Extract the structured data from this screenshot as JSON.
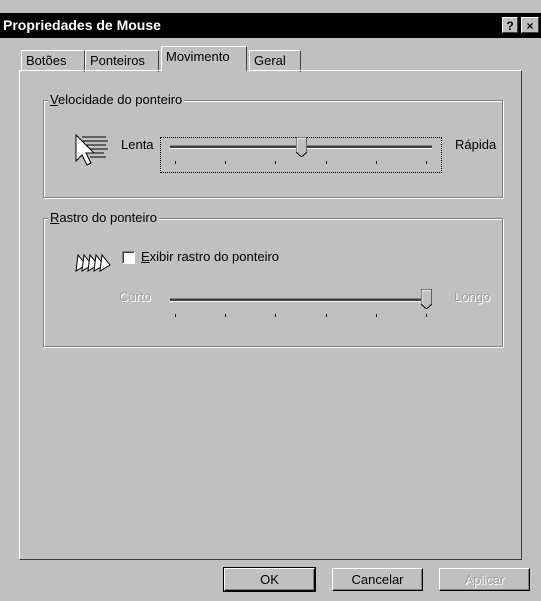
{
  "window": {
    "title": "Propriedades de Mouse",
    "help_label": "?",
    "close_label": "×"
  },
  "tabs": [
    {
      "label": "Botões",
      "active": false
    },
    {
      "label": "Ponteiros",
      "active": false
    },
    {
      "label": "Movimento",
      "active": true
    },
    {
      "label": "Geral",
      "active": false
    }
  ],
  "speed_group": {
    "legend_mnemonic": "V",
    "legend_rest": "elocidade do ponteiro",
    "min_label": "Lenta",
    "max_label": "Rápida",
    "value_fraction": 0.5,
    "icon": "pointer-speed-icon"
  },
  "trail_group": {
    "legend_mnemonic": "R",
    "legend_rest": "astro do ponteiro",
    "checkbox_mnemonic": "E",
    "checkbox_rest": "xibir rastro do ponteiro",
    "checked": false,
    "min_label": "Curto",
    "max_label": "Longo",
    "value_fraction": 1.0,
    "enabled": false,
    "icon": "pointer-trail-icon"
  },
  "buttons": {
    "ok": "OK",
    "cancel": "Cancelar",
    "apply": "Aplicar"
  },
  "colors": {
    "face": "#c0c0c0",
    "titlebar": "#000000"
  }
}
